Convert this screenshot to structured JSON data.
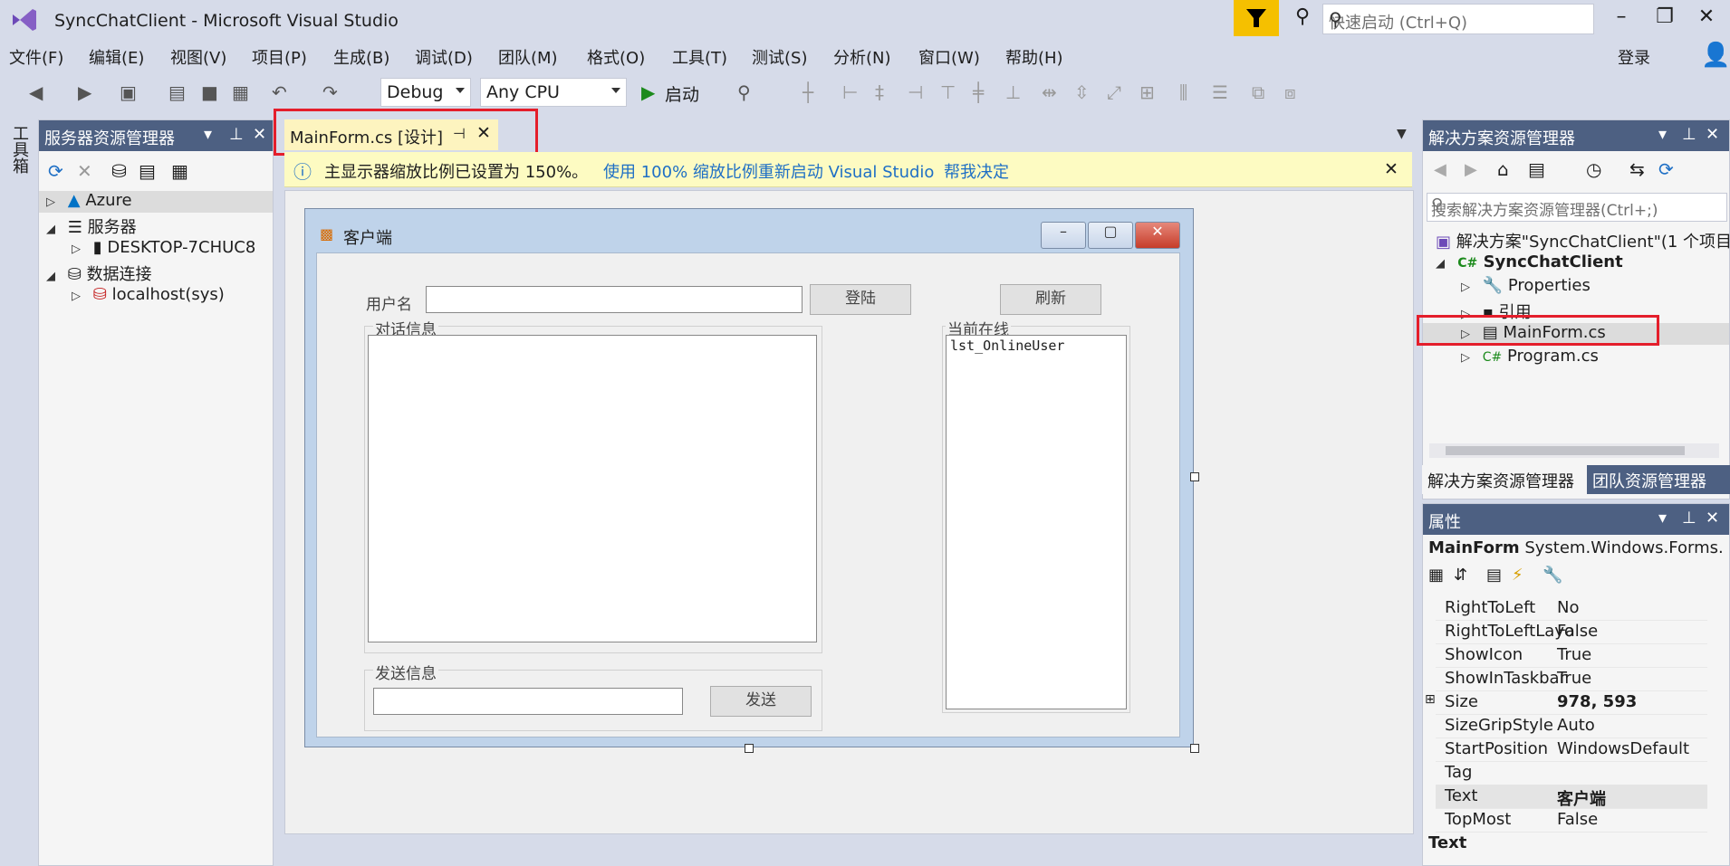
{
  "window": {
    "title": "SyncChatClient - Microsoft Visual Studio",
    "quick_launch_placeholder": "快速启动 (Ctrl+Q)"
  },
  "menu": [
    "文件(F)",
    "编辑(E)",
    "视图(V)",
    "项目(P)",
    "生成(B)",
    "调试(D)",
    "团队(M)",
    "格式(O)",
    "工具(T)",
    "测试(S)",
    "分析(N)",
    "窗口(W)",
    "帮助(H)"
  ],
  "login": "登录",
  "toolbar": {
    "config": "Debug",
    "platform": "Any CPU",
    "start": "启动"
  },
  "toolbox_label": "工具箱",
  "server_explorer": {
    "title": "服务器资源管理器",
    "items": [
      "Azure",
      "服务器",
      "DESKTOP-7CHUC8",
      "数据连接",
      "localhost(sys)"
    ]
  },
  "doc_tab": {
    "label": "MainForm.cs [设计]"
  },
  "infobar": {
    "message": "主显示器缩放比例已设置为 150%。",
    "link1": "使用 100% 缩放比例重新启动 Visual Studio",
    "link2": "帮我决定"
  },
  "form": {
    "title": "客户端",
    "username_label": "用户名",
    "login_button": "登陆",
    "refresh_button": "刷新",
    "dialog_group": "对话信息",
    "online_group": "当前在线",
    "online_list": "lst_OnlineUser",
    "send_group": "发送信息",
    "send_button": "发送"
  },
  "solution_explorer": {
    "title": "解决方案资源管理器",
    "search_placeholder": "搜索解决方案资源管理器(Ctrl+;)",
    "solution": "解决方案\"SyncChatClient\"(1 个项目",
    "project": "SyncChatClient",
    "items": [
      "Properties",
      "引用",
      "MainForm.cs",
      "Program.cs"
    ],
    "tabs": [
      "解决方案资源管理器",
      "团队资源管理器"
    ]
  },
  "properties": {
    "title": "属性",
    "object": "MainForm",
    "type": "System.Windows.Forms.",
    "rows": [
      {
        "name": "RightToLeft",
        "value": "No"
      },
      {
        "name": "RightToLeftLayo",
        "value": "False"
      },
      {
        "name": "ShowIcon",
        "value": "True"
      },
      {
        "name": "ShowInTaskbar",
        "value": "True"
      },
      {
        "name": "Size",
        "value": "978, 593"
      },
      {
        "name": "SizeGripStyle",
        "value": "Auto"
      },
      {
        "name": "StartPosition",
        "value": "WindowsDefault"
      },
      {
        "name": "Tag",
        "value": ""
      },
      {
        "name": "Text",
        "value": "客户端"
      },
      {
        "name": "TopMost",
        "value": "False"
      }
    ],
    "desc_title": "Text"
  },
  "colors": {
    "accent": "#e41e2b",
    "panel_head": "#4d6082",
    "tab_active": "#fdf4bf"
  }
}
